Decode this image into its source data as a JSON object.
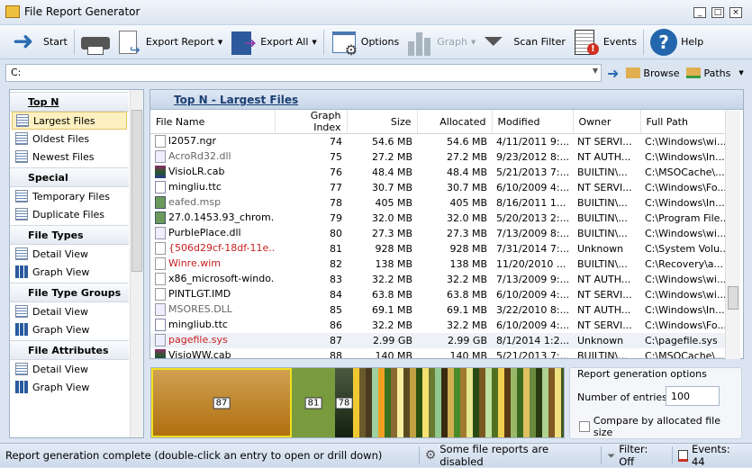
{
  "window": {
    "title": "File Report Generator"
  },
  "toolbar": {
    "start": "Start",
    "export_report": "Export Report",
    "export_all": "Export All",
    "options": "Options",
    "graph": "Graph",
    "scan_filter": "Scan Filter",
    "events": "Events",
    "help": "Help"
  },
  "pathbar": {
    "value": "C:",
    "browse": "Browse",
    "paths": "Paths"
  },
  "sidebar": {
    "sections": [
      {
        "title": "Top N",
        "items": [
          "Largest Files",
          "Oldest Files",
          "Newest Files"
        ]
      },
      {
        "title": "Special",
        "items": [
          "Temporary Files",
          "Duplicate Files"
        ]
      },
      {
        "title": "File Types",
        "items": [
          "Detail View",
          "Graph View"
        ]
      },
      {
        "title": "File Type Groups",
        "items": [
          "Detail View",
          "Graph View"
        ]
      },
      {
        "title": "File Attributes",
        "items": [
          "Detail View",
          "Graph View"
        ]
      }
    ],
    "selected": "Largest Files"
  },
  "report": {
    "title": "Top N - Largest Files",
    "columns": [
      "File Name",
      "Graph Index",
      "Size",
      "Allocated",
      "Modified",
      "Owner",
      "Full Path"
    ],
    "rows": [
      [
        "l2057.ngr",
        "74",
        "54.6 MB",
        "54.6 MB",
        "4/11/2011 9:...",
        "NT SERVI...",
        "C:\\Windows\\wi..."
      ],
      [
        "AcroRd32.dll",
        "75",
        "27.2 MB",
        "27.2 MB",
        "9/23/2012 8:...",
        "NT AUTH...",
        "C:\\Windows\\In..."
      ],
      [
        "VisioLR.cab",
        "76",
        "48.4 MB",
        "48.4 MB",
        "5/21/2013 7:...",
        "BUILTIN\\...",
        "C:\\MSOCache\\..."
      ],
      [
        "mingliu.ttc",
        "77",
        "30.7 MB",
        "30.7 MB",
        "6/10/2009 4:...",
        "NT SERVI...",
        "C:\\Windows\\Fo..."
      ],
      [
        "eafed.msp",
        "78",
        "405 MB",
        "405 MB",
        "8/16/2011 1...",
        "BUILTIN\\...",
        "C:\\Windows\\In..."
      ],
      [
        "27.0.1453.93_chrom...",
        "79",
        "32.0 MB",
        "32.0 MB",
        "5/20/2013 2:...",
        "BUILTIN\\...",
        "C:\\Program File..."
      ],
      [
        "PurblePlace.dll",
        "80",
        "27.3 MB",
        "27.3 MB",
        "7/13/2009 8:...",
        "BUILTIN\\...",
        "C:\\Windows\\wi..."
      ],
      [
        "{506d29cf-18df-11e...",
        "81",
        "928 MB",
        "928 MB",
        "7/31/2014 7:...",
        "Unknown",
        "C:\\System Volu..."
      ],
      [
        "Winre.wim",
        "82",
        "138 MB",
        "138 MB",
        "11/20/2010 ...",
        "BUILTIN\\...",
        "C:\\Recovery\\a..."
      ],
      [
        "x86_microsoft-windo...",
        "83",
        "32.2 MB",
        "32.2 MB",
        "7/13/2009 9:...",
        "NT AUTH...",
        "C:\\Windows\\wi..."
      ],
      [
        "PINTLGT.IMD",
        "84",
        "63.8 MB",
        "63.8 MB",
        "6/10/2009 4:...",
        "NT SERVI...",
        "C:\\Windows\\wi..."
      ],
      [
        "MSORES.DLL",
        "85",
        "69.1 MB",
        "69.1 MB",
        "3/22/2010 8:...",
        "NT AUTH...",
        "C:\\Windows\\In..."
      ],
      [
        "mingliub.ttc",
        "86",
        "32.2 MB",
        "32.2 MB",
        "6/10/2009 4:...",
        "NT SERVI...",
        "C:\\Windows\\Fo..."
      ],
      [
        "pagefile.sys",
        "87",
        "2.99 GB",
        "2.99 GB",
        "8/1/2014 1:2...",
        "Unknown",
        "C:\\pagefile.sys"
      ],
      [
        "VisioWW.cab",
        "88",
        "140 MB",
        "140 MB",
        "5/21/2013 7:...",
        "BUILTIN\\...",
        "C:\\MSOCache\\..."
      ]
    ],
    "row_styles": [
      "",
      "gray",
      "",
      "",
      "gray",
      "",
      "",
      "red",
      "red",
      "",
      "",
      "gray",
      "",
      "red",
      ""
    ],
    "row_icons": [
      "file-icon",
      "dll-icon",
      "archive-icon",
      "font-icon",
      "installer-icon",
      "installer-icon",
      "dll-icon",
      "file-icon",
      "file-icon",
      "file-icon",
      "file-icon",
      "dll-icon",
      "font-icon",
      "dll-icon",
      "archive-icon"
    ],
    "selected_row": 13
  },
  "graph": {
    "labels": [
      "87",
      "81",
      "78"
    ],
    "colors": [
      "#c08a2c",
      "#7a9a3e",
      "#2f3f25",
      "#f0c830",
      "#6b5a2a",
      "#4a3a20",
      "#9fd0a0",
      "#f0a020",
      "#3a7020",
      "#8a6a30",
      "#f7eea0",
      "#5a4a20",
      "#c0a040",
      "#2a5010",
      "#f5e070",
      "#6a7a30",
      "#90c890",
      "#3a2a10",
      "#d0b050",
      "#4a8a2a",
      "#a07a30",
      "#e8e890",
      "#2a4a15",
      "#7a5a20",
      "#c0e0a0",
      "#507020",
      "#f0d050",
      "#5a3a15",
      "#98b868",
      "#3a6a20",
      "#e0c060",
      "#6a8a40",
      "#2a3a10",
      "#b0d090",
      "#805a25",
      "#f0e080",
      "#405a20"
    ]
  },
  "options": {
    "group_title": "Report generation options",
    "entries_label": "Number of entries:",
    "entries_value": "100",
    "compare_label": "Compare by allocated file size",
    "compare_checked": false
  },
  "status": {
    "message": "Report generation complete (double-click an entry to open or drill down)",
    "disabled": "Some file reports are disabled",
    "filter": "Filter: Off",
    "events": "Events: 44"
  }
}
